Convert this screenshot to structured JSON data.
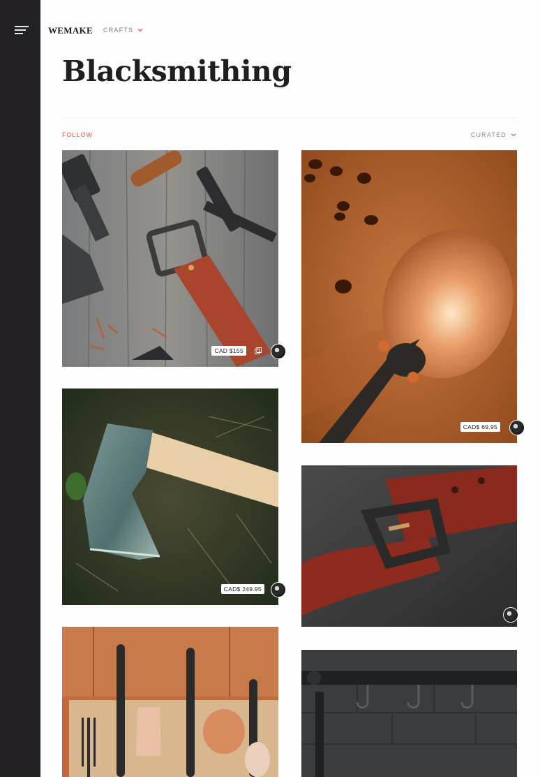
{
  "sidebar": {
    "menu_icon": "hamburger-menu-icon"
  },
  "header": {
    "brand": "WEMAKE",
    "category": "CRAFTS",
    "category_icon": "chevron-down-icon"
  },
  "page": {
    "title": "Blacksmithing",
    "follow_label": "FOLLOW",
    "sort_label": "CURATED",
    "sort_icon": "chevron-down-icon"
  },
  "colors": {
    "sidebar_bg": "#232125",
    "accent": "#e2563b",
    "text_dark": "#1f1f1f"
  },
  "products": [
    {
      "subject": "leather-belt-and-tools",
      "price": "CAD $155",
      "has_multi_icon": true
    },
    {
      "subject": "hammered-copper-ladle",
      "price": "CAD$ 69.95",
      "has_multi_icon": false
    },
    {
      "subject": "forged-axe",
      "price": "CAD$ 249.95",
      "has_multi_icon": false
    },
    {
      "subject": "red-leather-belt-buckle",
      "price": "",
      "has_multi_icon": false
    },
    {
      "subject": "kitchen-utensils-set",
      "price": "",
      "has_multi_icon": false
    },
    {
      "subject": "iron-hook-rack",
      "price": "",
      "has_multi_icon": false
    }
  ]
}
